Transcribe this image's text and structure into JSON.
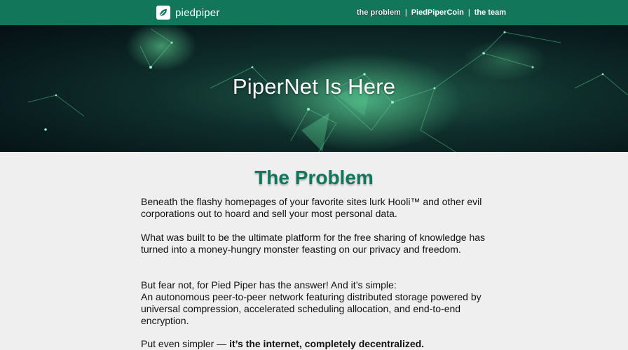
{
  "nav": {
    "brand": "piedpiper",
    "links": [
      "the problem",
      "PiedPiperCoin",
      "the team"
    ],
    "separator": "|"
  },
  "hero": {
    "title": "PiperNet Is Here"
  },
  "problem": {
    "title": "The Problem",
    "p1": "Beneath the flashy homepages of your favorite sites lurk Hooli™ and other evil corporations out to hoard and sell your most personal data.",
    "p2": "What was built to be the ultimate platform for the free sharing of knowledge has turned into a money-hungry monster feasting on our privacy and freedom.",
    "p3_line1": "But fear not, for Pied Piper has the answer! And it’s simple:",
    "p3_line2": "An autonomous peer-to-peer network featuring distributed storage powered by universal compression, accelerated scheduling allocation, and end-to-end encryption.",
    "p4_lead": "Put even simpler — ",
    "p4_bold": "it’s the internet, completely decentralized."
  },
  "colors": {
    "brand_green": "#12765a",
    "page_bg": "#efefef"
  }
}
